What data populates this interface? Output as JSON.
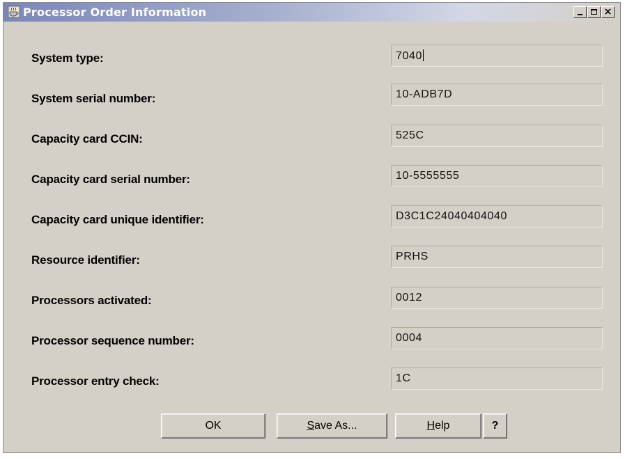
{
  "window": {
    "title": "Processor Order Information"
  },
  "controls": {
    "close_glyph": "×"
  },
  "rows": [
    {
      "label": "System type:",
      "value": "7040"
    },
    {
      "label": "System serial number:",
      "value": "10-ADB7D"
    },
    {
      "label": "Capacity card CCIN:",
      "value": "525C"
    },
    {
      "label": "Capacity card serial number:",
      "value": "10-5555555"
    },
    {
      "label": "Capacity card unique identifier:",
      "value": "D3C1C24040404040"
    },
    {
      "label": "Resource identifier:",
      "value": "PRHS"
    },
    {
      "label": "Processors activated:",
      "value": "0012"
    },
    {
      "label": "Processor sequence number:",
      "value": "0004"
    },
    {
      "label": "Processor entry check:",
      "value": "1C"
    }
  ],
  "buttons": {
    "ok": "OK",
    "save_mnemonic": "S",
    "save_rest": "ave As...",
    "help_mnemonic": "H",
    "help_rest": "elp",
    "question": "?"
  }
}
